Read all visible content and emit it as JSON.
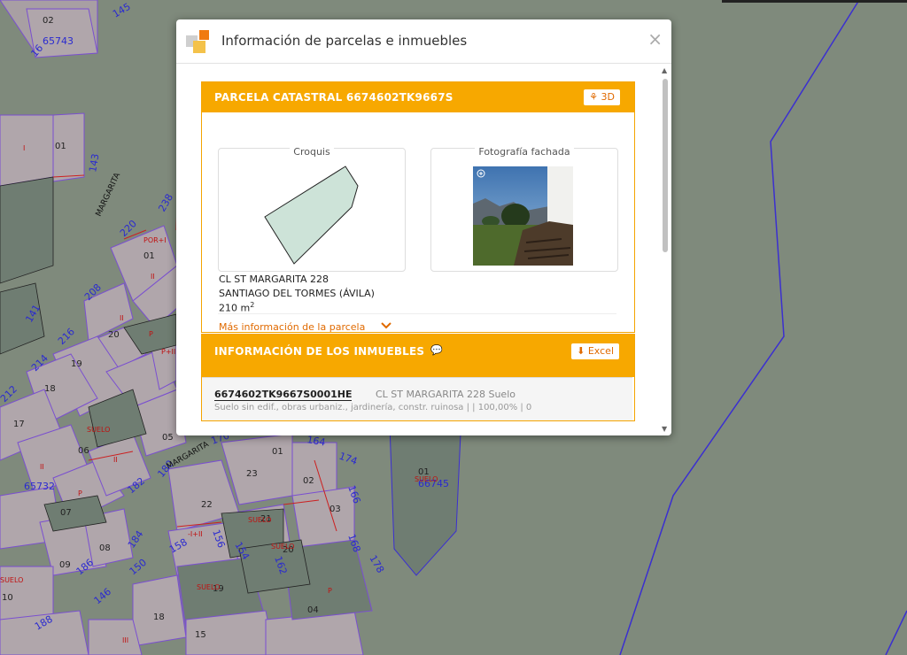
{
  "modal": {
    "title": "Información de parcelas e inmuebles",
    "close": "×"
  },
  "parcel": {
    "header": "PARCELA CATASTRAL 6674602TK9667S",
    "btn_3d": "3D",
    "croquis_label": "Croquis",
    "photo_label": "Fotografía fachada",
    "address_line1": "CL ST MARGARITA 228",
    "address_line2": "SANTIAGO DEL TORMES (ÁVILA)",
    "area_value": "210 m",
    "area_unit_sup": "2",
    "more_info": "Más información de la parcela"
  },
  "properties": {
    "header": "INFORMACIÓN DE LOS INMUEBLES",
    "excel_label": "Excel",
    "rows": [
      {
        "ref": "6674602TK9667S0001HE",
        "address": "CL ST MARGARITA 228 Suelo",
        "description": "Suelo sin edif., obras urbaniz., jardinería, constr. ruinosa |  | 100,00% | 0"
      }
    ]
  },
  "map": {
    "labels": {
      "street_margarita": "MARGARITA",
      "street_margarita2": "MARGARITA"
    },
    "parcel_numbers": [
      "02",
      "01",
      "01",
      "20",
      "19",
      "18",
      "17",
      "06",
      "07",
      "08",
      "09",
      "10",
      "05",
      "23",
      "02",
      "03",
      "22",
      "21",
      "20",
      "19",
      "18",
      "15",
      "04",
      "01",
      "01",
      "09"
    ],
    "blue_numbers": [
      "145",
      "143",
      "65743",
      "16",
      "141",
      "216",
      "214",
      "212",
      "208",
      "220",
      "238",
      "65732",
      "182",
      "180",
      "178",
      "170",
      "164",
      "174",
      "166",
      "168",
      "178",
      "162",
      "154",
      "158",
      "156",
      "150",
      "146",
      "186",
      "184",
      "188",
      "66745"
    ],
    "red_labels": [
      "I",
      "II",
      "P",
      "SUELO",
      "POR+I",
      "P+I",
      "-I+II",
      "III"
    ]
  }
}
